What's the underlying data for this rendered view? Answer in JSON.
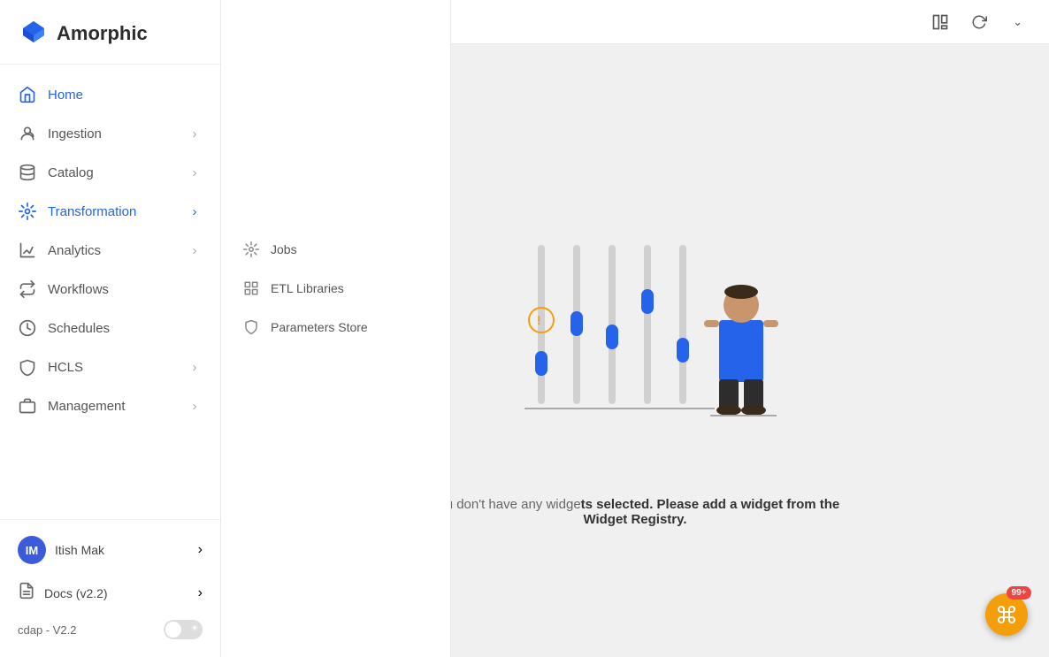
{
  "app": {
    "logo_text": "Amorphic",
    "url": "dev.cwdl.cloudwick.com/home"
  },
  "sidebar": {
    "items": [
      {
        "id": "home",
        "label": "Home",
        "active": true,
        "has_chevron": false
      },
      {
        "id": "ingestion",
        "label": "Ingestion",
        "active": false,
        "has_chevron": true
      },
      {
        "id": "catalog",
        "label": "Catalog",
        "active": false,
        "has_chevron": true
      },
      {
        "id": "transformation",
        "label": "Transformation",
        "active": true,
        "has_chevron": true
      },
      {
        "id": "analytics",
        "label": "Analytics",
        "active": false,
        "has_chevron": true
      },
      {
        "id": "workflows",
        "label": "Workflows",
        "active": false,
        "has_chevron": false
      },
      {
        "id": "schedules",
        "label": "Schedules",
        "active": false,
        "has_chevron": false
      },
      {
        "id": "hcls",
        "label": "HCLS",
        "active": false,
        "has_chevron": true
      },
      {
        "id": "management",
        "label": "Management",
        "active": false,
        "has_chevron": true
      }
    ],
    "user": {
      "initials": "IM",
      "name": "Itish Mak"
    },
    "docs": {
      "label": "Docs (v2.2)"
    },
    "version": "cdap - V2.2"
  },
  "dropdown": {
    "items": [
      {
        "id": "jobs",
        "label": "Jobs"
      },
      {
        "id": "etl-libraries",
        "label": "ETL Libraries"
      },
      {
        "id": "parameters-store",
        "label": "Parameters Store"
      }
    ]
  },
  "main": {
    "empty_state": {
      "text_start": "You don't have any widge",
      "text_bold": "ts selected. Please add a widget from the Widget Registry.",
      "full": "You don't have any widgets selected. Please add a widget from the Widget Registry."
    }
  },
  "colors": {
    "accent": "#2563eb",
    "avatar_bg": "#3b5bdb"
  }
}
